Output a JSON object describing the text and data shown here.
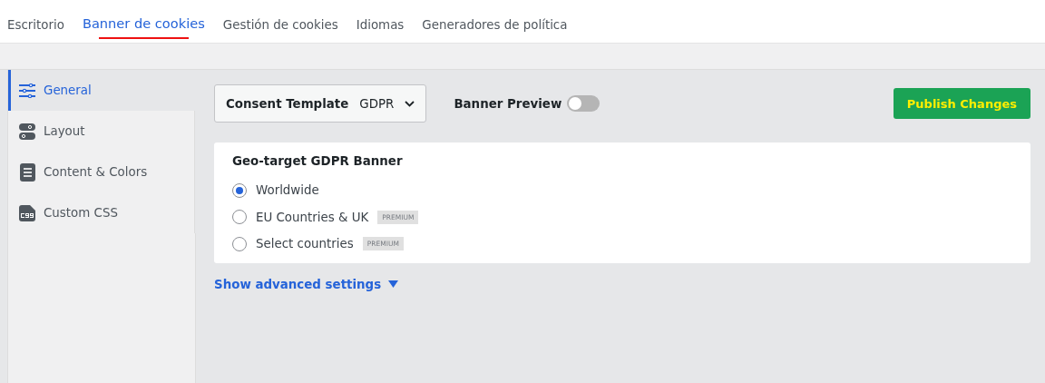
{
  "nav_tabs": [
    {
      "label": "Escritorio",
      "selected": false
    },
    {
      "label": "Banner de cookies",
      "selected": true
    },
    {
      "label": "Gestión de cookies",
      "selected": false
    },
    {
      "label": "Idiomas",
      "selected": false
    },
    {
      "label": "Generadores de política",
      "selected": false
    }
  ],
  "sidebar": {
    "items": [
      {
        "label": "General",
        "selected": true
      },
      {
        "label": "Layout",
        "selected": false
      },
      {
        "label": "Content & Colors",
        "selected": false
      },
      {
        "label": "Custom CSS",
        "selected": false
      }
    ]
  },
  "toolbar": {
    "template_label": "Consent Template",
    "template_value": "GDPR",
    "preview_label": "Banner Preview",
    "preview_on": false,
    "publish_button": "Publish Changes"
  },
  "geo_card": {
    "title": "Geo-target GDPR Banner",
    "options": [
      {
        "label": "Worldwide",
        "selected": true
      },
      {
        "label": "EU Countries & UK",
        "selected": false,
        "badge": "PREMIUM"
      },
      {
        "label": "Select countries",
        "selected": false,
        "badge": "PREMIUM"
      }
    ]
  },
  "advanced_link": "Show advanced settings"
}
